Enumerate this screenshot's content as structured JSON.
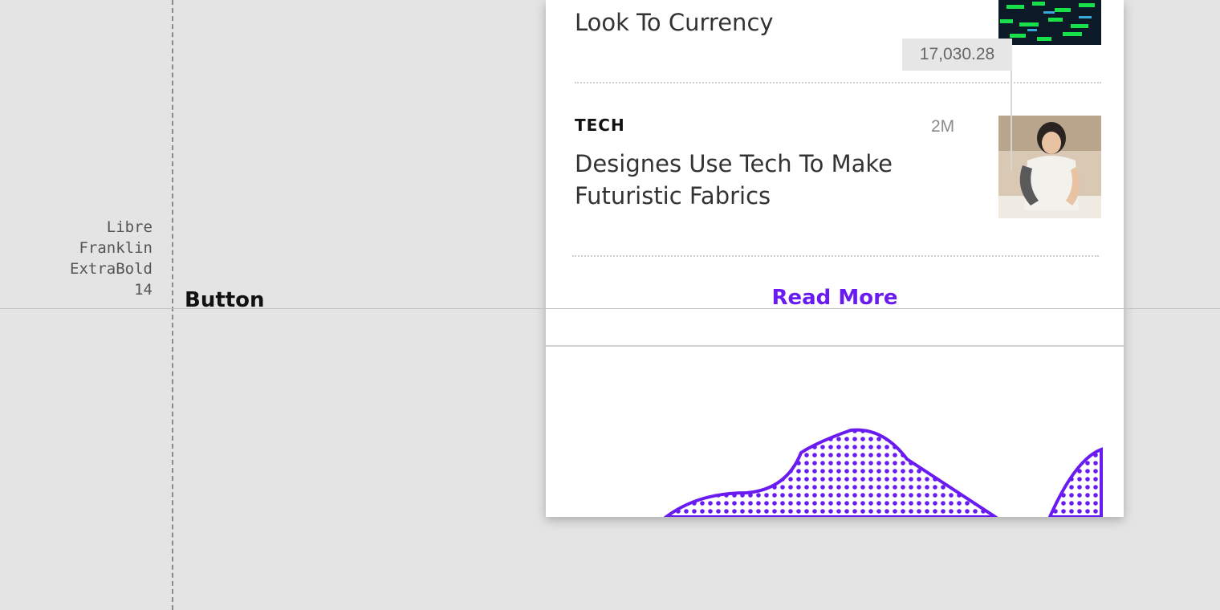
{
  "spec": {
    "font_label_lines": [
      "Libre",
      "Franklin",
      "ExtraBold",
      "14"
    ],
    "component_name": "Button"
  },
  "articles": [
    {
      "category": "",
      "time": "",
      "headline_lines": [
        "Look To Currency"
      ],
      "image": "stock-ticker-image"
    },
    {
      "category": "TECH",
      "time": "2M",
      "headline_lines": [
        "Designes Use Tech To Make",
        "Futuristic Fabrics"
      ],
      "image": "woman-tattoo-image"
    }
  ],
  "read_more_label": "Read More",
  "chart": {
    "highlight_value": "17,030.28",
    "accent_color": "#6a1bf2"
  },
  "chart_data": {
    "type": "area",
    "title": "",
    "annotations": [
      "17,030.28"
    ]
  }
}
